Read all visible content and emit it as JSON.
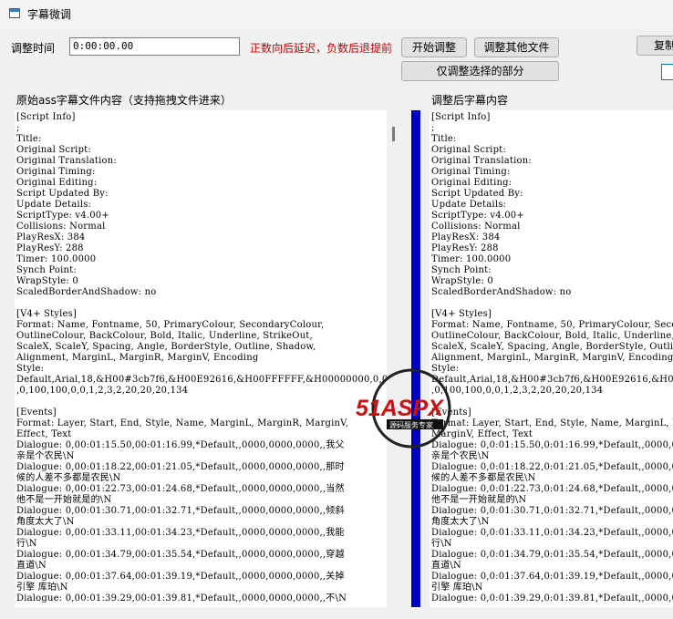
{
  "window": {
    "title": "字幕微调"
  },
  "controls": {
    "adjust_time_label": "调整时间",
    "time_value": "0:00:00.00",
    "hint": "正数向后延迟，负数后退提前",
    "start_button": "开始调整",
    "other_files_button": "调整其他文件",
    "selection_button": "仅调整选择的部分",
    "copy_button": "复制"
  },
  "panels": {
    "left_label": "原始ass字幕文件内容（支持拖拽文件进来）",
    "right_label": "调整后字幕内容",
    "left_text": "[Script Info]\n;\nTitle:\nOriginal Script:\nOriginal Translation:\nOriginal Timing:\nOriginal Editing:\nScript Updated By:\nUpdate Details:\nScriptType: v4.00+\nCollisions: Normal\nPlayResX: 384\nPlayResY: 288\nTimer: 100.0000\nSynch Point:\nWrapStyle: 0\nScaledBorderAndShadow: no\n\n[V4+ Styles]\nFormat: Name, Fontname, 50, PrimaryColour, SecondaryColour,\nOutlineColour, BackColour, Bold, Italic, Underline, StrikeOut,\nScaleX, ScaleY, Spacing, Angle, BorderStyle, Outline, Shadow,\nAlignment, MarginL, MarginR, MarginV, Encoding\nStyle:\nDefault,Arial,18,&H00#3cb7f6,&H00E92616,&H00FFFFFF,&H00000000,0,0,0\n,0,100,100,0,0,1,2,3,2,20,20,20,134\n\n[Events]\nFormat: Layer, Start, End, Style, Name, MarginL, MarginR, MarginV,\nEffect, Text\nDialogue: 0,00:01:15.50,00:01:16.99,*Default,,0000,0000,0000,,我父\n亲是个农民\\N\nDialogue: 0,00:01:18.22,00:01:21.05,*Default,,0000,0000,0000,,那时\n候的人差不多都是农民\\N\nDialogue: 0,00:01:22.73,00:01:24.68,*Default,,0000,0000,0000,,当然\n他不是一开始就是的\\N\nDialogue: 0,00:01:30.71,00:01:32.71,*Default,,0000,0000,0000,,倾斜\n角度太大了\\N\nDialogue: 0,00:01:33.11,00:01:34.23,*Default,,0000,0000,0000,,我能\n行\\N\nDialogue: 0,00:01:34.79,00:01:35.54,*Default,,0000,0000,0000,,穿越\n直道\\N\nDialogue: 0,00:01:37.64,00:01:39.19,*Default,,0000,0000,0000,,关掉\n引擎 库珀\\N\nDialogue: 0,00:01:39.29,00:01:39.81,*Default,,0000,0000,0000,,不\\N",
    "right_text": "[Script Info]\n;\nTitle:\nOriginal Script:\nOriginal Translation:\nOriginal Timing:\nOriginal Editing:\nScript Updated By:\nUpdate Details:\nScriptType: v4.00+\nCollisions: Normal\nPlayResX: 384\nPlayResY: 288\nTimer: 100.0000\nSynch Point:\nWrapStyle: 0\nScaledBorderAndShadow: no\n\n[V4+ Styles]\nFormat: Name, Fontname, 50, PrimaryColour, SecondaryColour,\nOutlineColour, BackColour, Bold, Italic, Underline, StrikeOut,\nScaleX, ScaleY, Spacing, Angle, BorderStyle, Outline, Shadow,\nAlignment, MarginL, MarginR, MarginV, Encoding\nStyle:\nDefault,Arial,18,&H00#3cb7f6,&H00E92616,&H00FFFFFF,&H00000000,0,0,0\n,0,100,100,0,0,1,2,3,2,20,20,20,134\n\n[Events]\nFormat: Layer, Start, End, Style, Name, MarginL, MarginR,\nMarginV, Effect, Text\nDialogue: 0,0:01:15.50,0:01:16.99,*Default,,0000,0000,0000,,我父\n亲是个农民\\N\nDialogue: 0,0:01:18.22,0:01:21.05,*Default,,0000,0000,0000,,那时\n候的人差不多都是农民\\N\nDialogue: 0,0:01:22.73,0:01:24.68,*Default,,0000,0000,0000,,当然\n他不是一开始就是的\\N\nDialogue: 0,0:01:30.71,0:01:32.71,*Default,,0000,0000,0000,,倾斜\n角度太大了\\N\nDialogue: 0,0:01:33.11,0:01:34.23,*Default,,0000,0000,0000,,我能\n行\\N\nDialogue: 0,0:01:34.79,0:01:35.54,*Default,,0000,0000,0000,,穿越\n直道\\N\nDialogue: 0,0:01:37.64,0:01:39.19,*Default,,0000,0000,0000,,关掉\n引擎 库珀\\N\nDialogue: 0,0:01:39.29,0:01:39.81,*Default,,0000,0000,0000,,不\\N"
  },
  "watermark": {
    "text": "51ASPX",
    "subtext": "源码服务专家"
  },
  "colors": {
    "hint": "#d00000",
    "divider": "#0000c0",
    "watermark": "#d01010"
  }
}
